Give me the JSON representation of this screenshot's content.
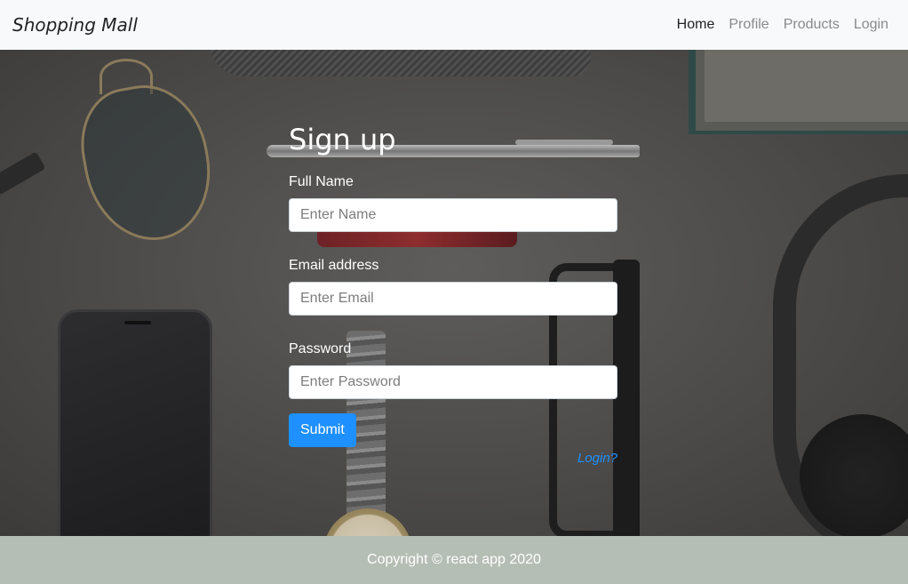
{
  "navbar": {
    "brand": "Shopping Mall",
    "links": [
      {
        "label": "Home",
        "active": true
      },
      {
        "label": "Profile",
        "active": false
      },
      {
        "label": "Products",
        "active": false
      },
      {
        "label": "Login",
        "active": false
      }
    ]
  },
  "form": {
    "title": "Sign up",
    "name": {
      "label": "Full Name",
      "placeholder": "Enter Name",
      "value": ""
    },
    "email": {
      "label": "Email address",
      "placeholder": "Enter Email",
      "value": ""
    },
    "password": {
      "label": "Password",
      "placeholder": "Enter Password",
      "value": ""
    },
    "submit_label": "Submit",
    "login_link": "Login?"
  },
  "footer": {
    "text": "Copyright © react app 2020"
  },
  "colors": {
    "accent": "#1e90ff",
    "navbar_bg": "#f8f9fa",
    "footer_bg": "#b5beb5"
  }
}
